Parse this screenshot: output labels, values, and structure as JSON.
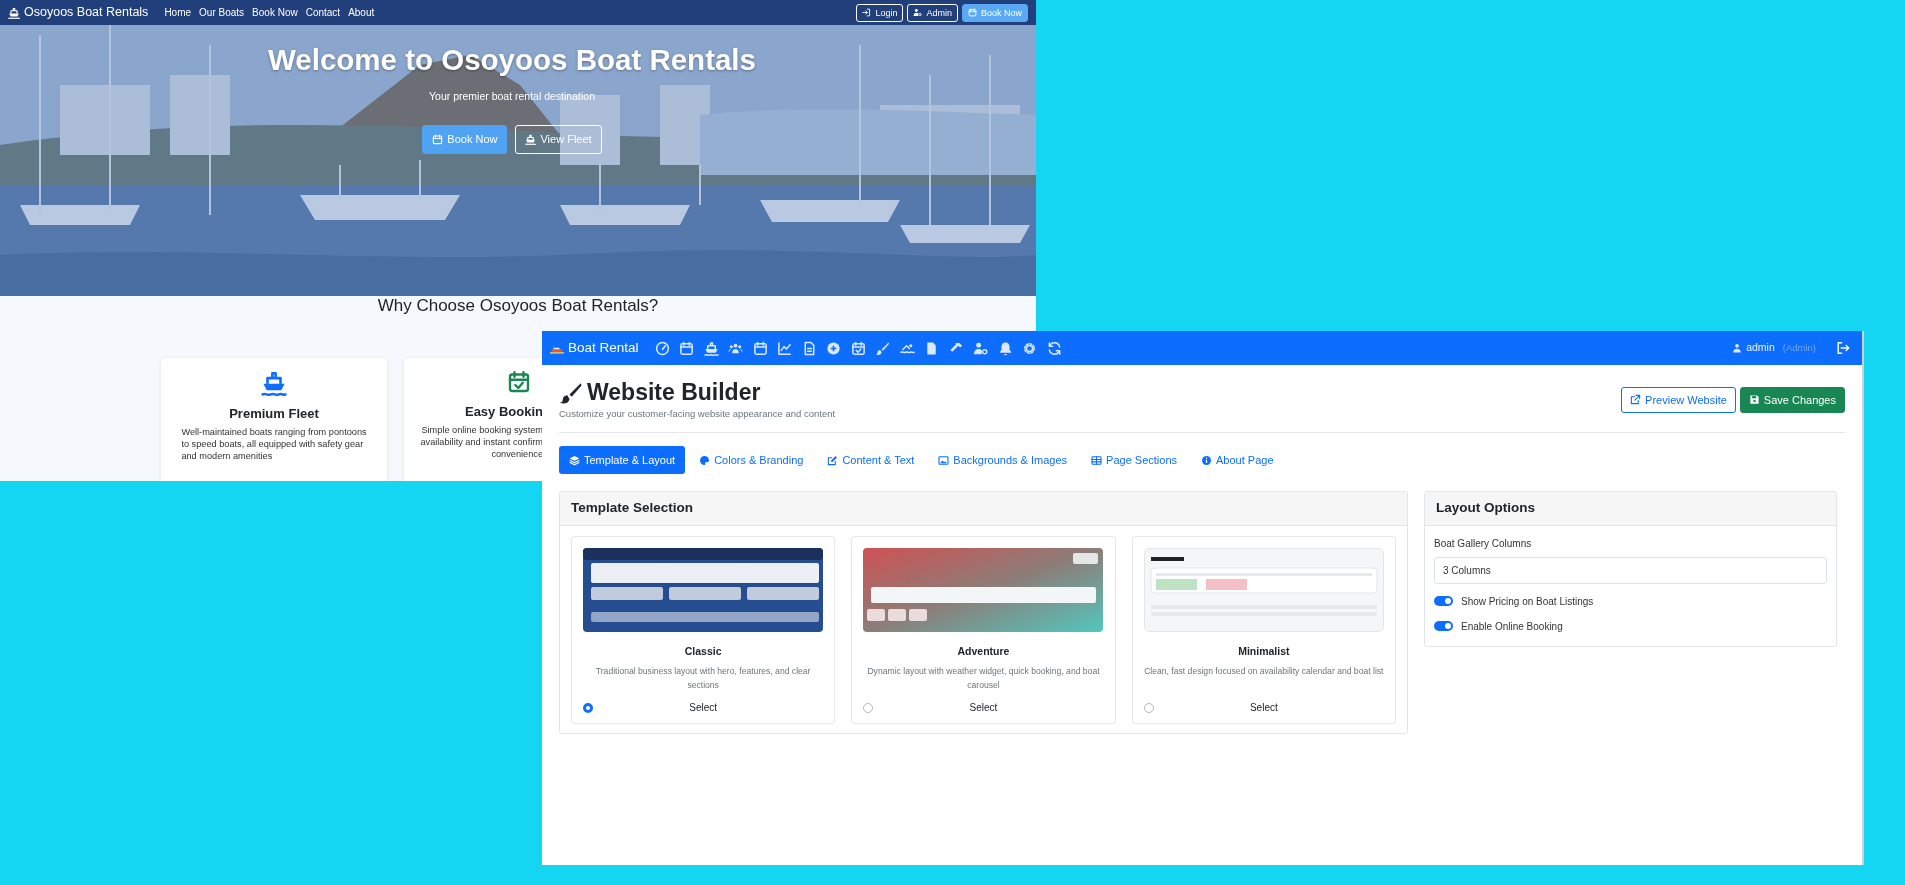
{
  "website_window": {
    "navbar": {
      "brand": "Osoyoos Boat Rentals",
      "links": [
        {
          "label": "Home"
        },
        {
          "label": "Our Boats"
        },
        {
          "label": "Book Now"
        },
        {
          "label": "Contact"
        },
        {
          "label": "About"
        }
      ],
      "buttons": [
        {
          "label": "Login",
          "kind": "outline"
        },
        {
          "label": "Admin",
          "kind": "outline"
        },
        {
          "label": "Book Now",
          "kind": "primary"
        }
      ]
    },
    "hero": {
      "title": "Welcome to Osoyoos Boat Rentals",
      "subtitle": "Your premier boat rental destination",
      "buttons": [
        {
          "label": "Book Now",
          "kind": "primary"
        },
        {
          "label": "View Fleet",
          "kind": "outline"
        }
      ]
    },
    "features": {
      "heading": "Why Choose Osoyoos Boat Rentals?",
      "cards": [
        {
          "title": "Premium Fleet",
          "description_lines": [
            "Well-maintained boats ranging from pontoons",
            "to speed boats, all equipped with safety gear",
            "and modern amenities"
          ]
        },
        {
          "title": "Easy Bookin",
          "description_lines": [
            "Simple online booking system",
            "availability and instant confirm",
            "convenience"
          ]
        }
      ]
    }
  },
  "admin_window": {
    "navbar": {
      "brand": "Boat Rental",
      "user": "admin",
      "role": "(Admin)"
    },
    "header": {
      "title": "Website Builder",
      "subtitle": "Customize your customer-facing website appearance and content",
      "buttons": [
        {
          "label": "Preview Website",
          "kind": "outline"
        },
        {
          "label": "Save Changes",
          "kind": "success"
        }
      ]
    },
    "tabs": [
      {
        "label": "Template & Layout",
        "selected": true
      },
      {
        "label": "Colors & Branding",
        "selected": false
      },
      {
        "label": "Content & Text",
        "selected": false
      },
      {
        "label": "Backgrounds & Images",
        "selected": false
      },
      {
        "label": "Page Sections",
        "selected": false
      },
      {
        "label": "About Page",
        "selected": false
      }
    ],
    "template_selection": {
      "title": "Template Selection",
      "templates": [
        {
          "kind": "classic",
          "name": "Classic",
          "description": "Traditional business layout with hero, features, and clear sections",
          "action": "Select",
          "selected": true
        },
        {
          "kind": "adventure",
          "name": "Adventure",
          "description": "Dynamic layout with weather widget, quick booking, and boat carousel",
          "action": "Select",
          "selected": false
        },
        {
          "kind": "minimalist",
          "name": "Minimalist",
          "description": "Clean, fast design focused on availability calendar and boat list",
          "action": "Select",
          "selected": false
        }
      ]
    },
    "layout_options": {
      "title": "Layout Options",
      "fields": [
        {
          "kind": "select",
          "label": "Boat Gallery Columns",
          "value": "3 Columns"
        },
        {
          "kind": "switch",
          "label": "Show Pricing on Boat Listings",
          "on": true
        },
        {
          "kind": "switch",
          "label": "Enable Online Booking",
          "on": true
        }
      ]
    }
  }
}
